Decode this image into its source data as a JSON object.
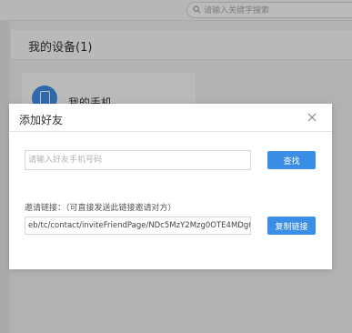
{
  "header": {
    "search_placeholder": "请输入关键字搜索"
  },
  "devices": {
    "title": "我的设备(1)",
    "items": [
      {
        "name": "我的手机",
        "icon": "phone-icon"
      }
    ]
  },
  "dialog": {
    "title": "添加好友",
    "phone_placeholder": "请输入好友手机号码",
    "search_label": "查找",
    "invite_label": "邀请链接：（可直接发送此链接邀请对方）",
    "invite_link": "eb/tc/contact/inviteFriendPage/NDc5MzY2Mzg0OTE4MDg0MzY5Ng==",
    "copy_label": "复制链接",
    "close_icon": "close-icon"
  },
  "colors": {
    "accent": "#3a8ee6",
    "device_icon": "#3f8ce6",
    "overlay": "rgba(0,0,0,0.25)"
  }
}
